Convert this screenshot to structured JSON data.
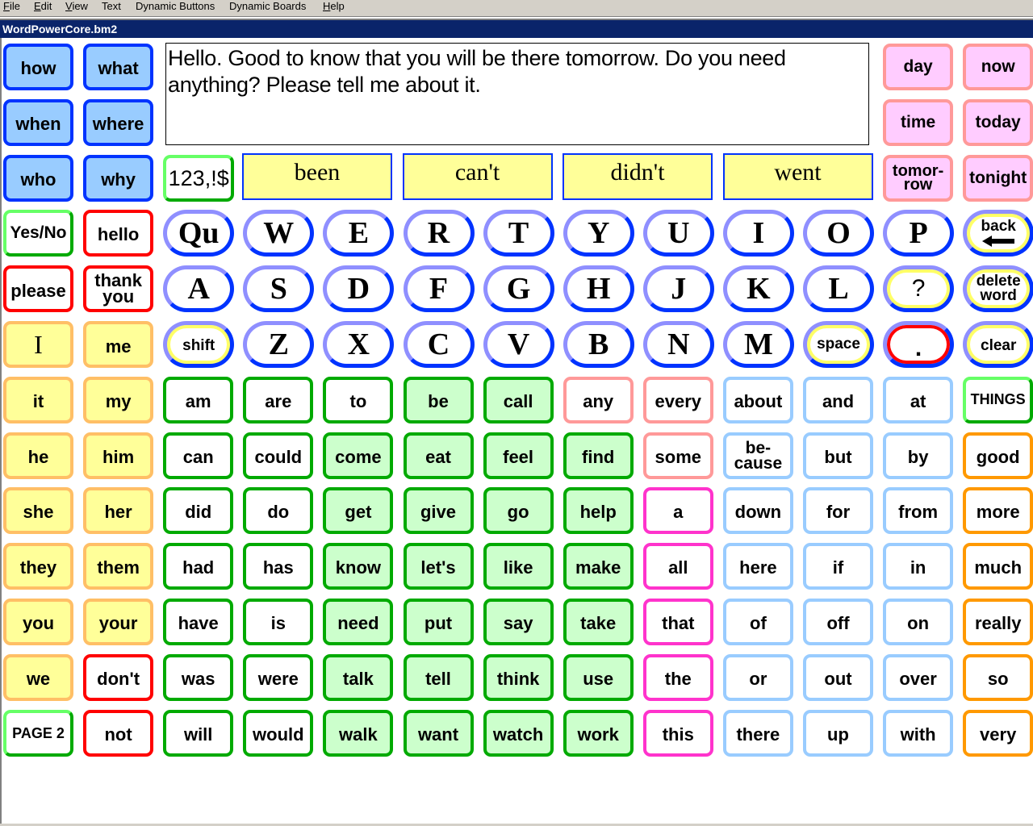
{
  "menubar": {
    "items": [
      {
        "label": "File",
        "accel": "F",
        "rest": "ile"
      },
      {
        "label": "Edit",
        "accel": "E",
        "rest": "dit"
      },
      {
        "label": "View",
        "accel": "V",
        "rest": "iew"
      },
      {
        "label": "Text",
        "accel": "",
        "rest": "Text"
      },
      {
        "label": "Dynamic Buttons",
        "accel": "",
        "rest": "Dynamic Buttons"
      },
      {
        "label": "Dynamic Boards",
        "accel": "",
        "rest": "Dynamic Boards"
      },
      {
        "label": "Help",
        "accel": "H",
        "rest": "elp"
      }
    ]
  },
  "window": {
    "title": "WordPowerCore.bm2"
  },
  "message": {
    "text": "Hello.  Good to know that you will be there tomorrow.  Do you need anything?  Please tell me about it."
  },
  "colors": {
    "question_fill": "#99ccff",
    "question_border": "#0033ff",
    "time_fill": "#ffccff",
    "time_border": "#ff9999",
    "social_border": "#ff0000",
    "pronoun_fill": "#ffff99",
    "pronoun_border": "#ffbf66",
    "verb_border": "#00aa00",
    "verb_fill": "#ccffcc",
    "determiner_border": "#ff33cc",
    "preposition_border": "#99ccff",
    "adjective_border": "#ff9900",
    "key_border": "#0033ff",
    "prediction_fill": "#ffff99",
    "titlebar": "#0a246a"
  },
  "questions": [
    "how",
    "what",
    "when",
    "where",
    "who",
    "why"
  ],
  "time_words": [
    "day",
    "now",
    "time",
    "today",
    "tomor-\nrow",
    "tonight"
  ],
  "numbers_button": "123,!$",
  "predictions": [
    "been",
    "can't",
    "didn't",
    "went"
  ],
  "keyboard": {
    "row1": [
      "Qu",
      "W",
      "E",
      "R",
      "T",
      "Y",
      "U",
      "I",
      "O",
      "P"
    ],
    "row2": [
      "A",
      "S",
      "D",
      "F",
      "G",
      "H",
      "J",
      "K",
      "L"
    ],
    "row3": [
      "Z",
      "X",
      "C",
      "V",
      "B",
      "N",
      "M"
    ],
    "shift": "shift",
    "space": "space",
    "question_mark": "?",
    "period": ".",
    "back": "back",
    "delete_word": "delete\nword",
    "clear": "clear"
  },
  "left_panel": {
    "yes_no": "Yes/No",
    "hello": "hello",
    "please": "please",
    "thank_you": "thank\nyou",
    "i": "I",
    "me": "me"
  },
  "grid": {
    "rows": [
      [
        "it",
        "my",
        "am",
        "are",
        "to",
        "be",
        "call",
        "any",
        "every",
        "about",
        "and",
        "at",
        "THINGS"
      ],
      [
        "he",
        "him",
        "can",
        "could",
        "come",
        "eat",
        "feel",
        "find",
        "some",
        "be-\ncause",
        "but",
        "by",
        "good"
      ],
      [
        "she",
        "her",
        "did",
        "do",
        "get",
        "give",
        "go",
        "help",
        "a",
        "down",
        "for",
        "from",
        "more"
      ],
      [
        "they",
        "them",
        "had",
        "has",
        "know",
        "let's",
        "like",
        "make",
        "all",
        "here",
        "if",
        "in",
        "much"
      ],
      [
        "you",
        "your",
        "have",
        "is",
        "need",
        "put",
        "say",
        "take",
        "that",
        "of",
        "off",
        "on",
        "really"
      ],
      [
        "we",
        "don't",
        "was",
        "were",
        "talk",
        "tell",
        "think",
        "use",
        "the",
        "or",
        "out",
        "over",
        "so"
      ],
      [
        "PAGE 2",
        "not",
        "will",
        "would",
        "walk",
        "want",
        "watch",
        "work",
        "this",
        "there",
        "up",
        "with",
        "very"
      ]
    ]
  }
}
